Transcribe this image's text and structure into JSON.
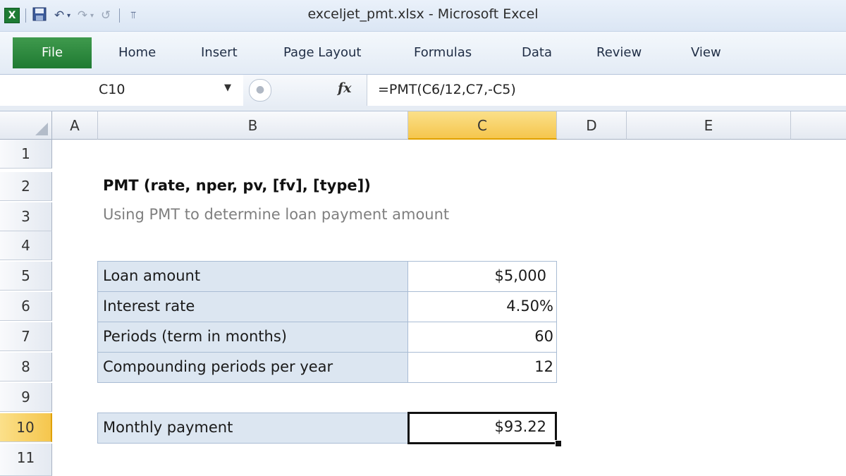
{
  "window": {
    "title": "exceljet_pmt.xlsx  -  Microsoft Excel",
    "logo_text": "X",
    "qat": {
      "save_icon": "💾",
      "undo_icon": "↶",
      "caret": "▾",
      "redo_icon": "↷",
      "repeat_icon": "↺",
      "customize_icon": "⫪"
    }
  },
  "ribbon": {
    "tabs": [
      "File",
      "Home",
      "Insert",
      "Page Layout",
      "Formulas",
      "Data",
      "Review",
      "View"
    ]
  },
  "formula_bar": {
    "name_box": "C10",
    "name_box_arrow": "▼",
    "circle": "●",
    "fx_label": "fx",
    "formula": "=PMT(C6/12,C7,-C5)"
  },
  "grid": {
    "columns": [
      "A",
      "B",
      "C",
      "D",
      "E"
    ],
    "selected_column": "C",
    "rows": [
      "1",
      "2",
      "3",
      "4",
      "5",
      "6",
      "7",
      "8",
      "9",
      "10",
      "11"
    ],
    "selected_row": "10"
  },
  "sheet": {
    "title": "PMT (rate, nper, pv, [fv], [type])",
    "subtitle": "Using PMT to determine loan payment amount",
    "inputs": [
      {
        "label": "Loan amount",
        "value": "$5,000 "
      },
      {
        "label": "Interest rate",
        "value": "4.50%"
      },
      {
        "label": "Periods (term in months)",
        "value": "60"
      },
      {
        "label": "Compounding periods per year",
        "value": "12"
      }
    ],
    "result": {
      "label": "Monthly payment",
      "value": "$93.22"
    }
  },
  "colors": {
    "file_tab": "#2a8a3e",
    "selected_header": "#f5c64d",
    "label_fill": "#dce6f1"
  }
}
